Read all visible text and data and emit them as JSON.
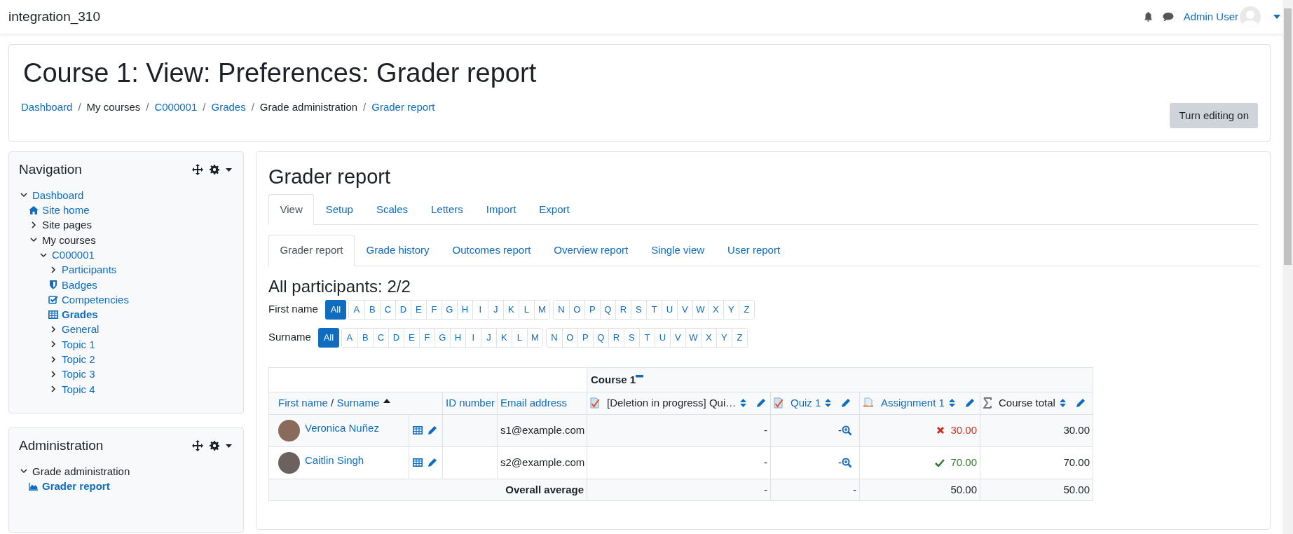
{
  "navbar": {
    "site_name": "integration_310",
    "user_name": "Admin User"
  },
  "header": {
    "title": "Course 1: View: Preferences: Grader report",
    "breadcrumbs": [
      {
        "label": "Dashboard",
        "link": true
      },
      {
        "label": "My courses",
        "link": false,
        "separator": "/"
      },
      {
        "label": "C000001",
        "link": true,
        "separator": "/"
      },
      {
        "label": "Grades",
        "link": true,
        "separator": "/"
      },
      {
        "label": "Grade administration",
        "link": false,
        "separator": "/"
      },
      {
        "label": "Grader report",
        "link": true,
        "separator": "/"
      }
    ],
    "button": "Turn editing on"
  },
  "blocks": [
    {
      "title": "Navigation",
      "items": [
        {
          "label": "Dashboard",
          "link": true,
          "active": false,
          "kind": "branch",
          "expanded": true,
          "children": [
            {
              "label": "Site home",
              "link": true,
              "active": false,
              "kind": "home"
            },
            {
              "label": "Site pages",
              "link": false,
              "active": false,
              "kind": "branch",
              "expanded": false
            },
            {
              "label": "My courses",
              "link": false,
              "active": false,
              "kind": "branch",
              "expanded": true,
              "children": [
                {
                  "label": "C000001",
                  "link": true,
                  "active": false,
                  "kind": "branch",
                  "expanded": true,
                  "children": [
                    {
                      "label": "Participants",
                      "link": true,
                      "active": false,
                      "kind": "branch",
                      "expanded": false
                    },
                    {
                      "label": "Badges",
                      "link": true,
                      "active": false,
                      "kind": "badges"
                    },
                    {
                      "label": "Competencies",
                      "link": true,
                      "active": false,
                      "kind": "competencies"
                    },
                    {
                      "label": "Grades",
                      "link": true,
                      "active": true,
                      "kind": "grades"
                    },
                    {
                      "label": "General",
                      "link": true,
                      "active": false,
                      "kind": "branch",
                      "expanded": false
                    },
                    {
                      "label": "Topic 1",
                      "link": true,
                      "active": false,
                      "kind": "branch",
                      "expanded": false
                    },
                    {
                      "label": "Topic 2",
                      "link": true,
                      "active": false,
                      "kind": "branch",
                      "expanded": false
                    },
                    {
                      "label": "Topic 3",
                      "link": true,
                      "active": false,
                      "kind": "branch",
                      "expanded": false
                    },
                    {
                      "label": "Topic 4",
                      "link": true,
                      "active": false,
                      "kind": "branch",
                      "expanded": false
                    }
                  ]
                }
              ]
            }
          ]
        }
      ]
    },
    {
      "title": "Administration",
      "items": [
        {
          "label": "Grade administration",
          "link": false,
          "active": false,
          "kind": "branch",
          "expanded": true,
          "children": [
            {
              "label": "Grader report",
              "link": true,
              "active": true,
              "kind": "report"
            }
          ]
        }
      ]
    }
  ],
  "main": {
    "title": "Grader report",
    "tabs": [
      {
        "label": "View",
        "selected": true
      },
      {
        "label": "Setup",
        "selected": false
      },
      {
        "label": "Scales",
        "selected": false
      },
      {
        "label": "Letters",
        "selected": false
      },
      {
        "label": "Import",
        "selected": false
      },
      {
        "label": "Export",
        "selected": false
      }
    ],
    "subtabs": [
      {
        "label": "Grader report",
        "selected": true
      },
      {
        "label": "Grade history",
        "selected": false
      },
      {
        "label": "Outcomes report",
        "selected": false
      },
      {
        "label": "Overview report",
        "selected": false
      },
      {
        "label": "Single view",
        "selected": false
      },
      {
        "label": "User report",
        "selected": false
      }
    ],
    "participants_heading": "All participants: 2/2",
    "initial_bars": [
      {
        "label": "First name",
        "all": {
          "label": "All",
          "selected": true
        },
        "groups": [
          [
            "A",
            "B",
            "C",
            "D",
            "E",
            "F",
            "G",
            "H",
            "I",
            "J",
            "K",
            "L",
            "M"
          ],
          [
            "N",
            "O",
            "P",
            "Q",
            "R",
            "S",
            "T",
            "U",
            "V",
            "W",
            "X",
            "Y",
            "Z"
          ]
        ]
      },
      {
        "label": "Surname",
        "all": {
          "label": "All",
          "selected": true
        },
        "groups": [
          [
            "A",
            "B",
            "C",
            "D",
            "E",
            "F",
            "G",
            "H",
            "I",
            "J",
            "K",
            "L",
            "M"
          ],
          [
            "N",
            "O",
            "P",
            "Q",
            "R",
            "S",
            "T",
            "U",
            "V",
            "W",
            "X",
            "Y",
            "Z"
          ]
        ]
      }
    ],
    "table": {
      "category": "Course 1",
      "name_header": {
        "first": "First name",
        "separator": "/",
        "last": "Surname"
      },
      "id_header": "ID number",
      "email_header": "Email address",
      "grade_columns": [
        {
          "label": "[Deletion in progress] Qui…",
          "kind": "quiz",
          "link": false
        },
        {
          "label": "Quiz 1",
          "kind": "quiz",
          "link": true
        },
        {
          "label": "Assignment 1",
          "kind": "assignment",
          "link": true
        },
        {
          "label": "Course total",
          "kind": "total",
          "link": false
        }
      ],
      "rows": [
        {
          "name": "Veronica Nuñez",
          "email": "s1@example.com",
          "grades": [
            {
              "value": "-",
              "kind": "plain",
              "zoom": false
            },
            {
              "value": "-",
              "kind": "plain",
              "zoom": true
            },
            {
              "value": "30.00",
              "kind": "fail",
              "zoom": false
            },
            {
              "value": "30.00",
              "kind": "plain",
              "zoom": false
            }
          ]
        },
        {
          "name": "Caitlin Singh",
          "email": "s2@example.com",
          "grades": [
            {
              "value": "-",
              "kind": "plain",
              "zoom": false
            },
            {
              "value": "-",
              "kind": "plain",
              "zoom": true
            },
            {
              "value": "70.00",
              "kind": "pass",
              "zoom": false
            },
            {
              "value": "70.00",
              "kind": "plain",
              "zoom": false
            }
          ]
        }
      ],
      "average": {
        "label": "Overall average",
        "values": [
          "-",
          "-",
          "50.00",
          "50.00"
        ]
      }
    }
  }
}
